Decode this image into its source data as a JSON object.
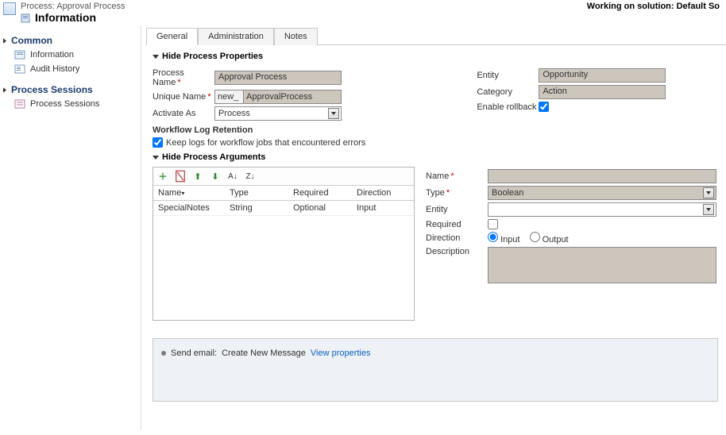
{
  "header": {
    "process_label": "Process: Approval Process",
    "title": "Information",
    "working_on": "Working on solution: Default So"
  },
  "sidebar": {
    "groups": [
      {
        "title": "Common",
        "items": [
          {
            "label": "Information",
            "icon": "info-icon"
          },
          {
            "label": "Audit History",
            "icon": "audit-icon"
          }
        ]
      },
      {
        "title": "Process Sessions",
        "items": [
          {
            "label": "Process Sessions",
            "icon": "sessions-icon"
          }
        ]
      }
    ]
  },
  "tabs": [
    "General",
    "Administration",
    "Notes"
  ],
  "properties": {
    "section_title": "Hide Process Properties",
    "process_name_label": "Process Name",
    "process_name_value": "Approval Process",
    "unique_name_label": "Unique Name",
    "unique_name_prefix": "new_",
    "unique_name_value": "ApprovalProcess",
    "activate_as_label": "Activate As",
    "activate_as_value": "Process",
    "entity_label": "Entity",
    "entity_value": "Opportunity",
    "category_label": "Category",
    "category_value": "Action",
    "enable_rollback_label": "Enable rollback",
    "enable_rollback_checked": true,
    "wf_log_header": "Workflow Log Retention",
    "wf_log_option": "Keep logs for workflow jobs that encountered errors",
    "wf_log_checked": true
  },
  "arguments": {
    "section_title": "Hide Process Arguments",
    "columns": {
      "name": "Name",
      "type": "Type",
      "required": "Required",
      "direction": "Direction"
    },
    "rows": [
      {
        "name": "SpecialNotes",
        "type": "String",
        "required": "Optional",
        "direction": "Input"
      }
    ],
    "editor": {
      "name_label": "Name",
      "name_value": "",
      "type_label": "Type",
      "type_value": "Boolean",
      "entity_label": "Entity",
      "entity_value": "",
      "required_label": "Required",
      "required_checked": false,
      "direction_label": "Direction",
      "direction_input": "Input",
      "direction_output": "Output",
      "direction_selected": "input",
      "description_label": "Description"
    }
  },
  "steps": {
    "row_label": "Send email:",
    "row_value": "Create New Message",
    "view_props": "View properties"
  }
}
